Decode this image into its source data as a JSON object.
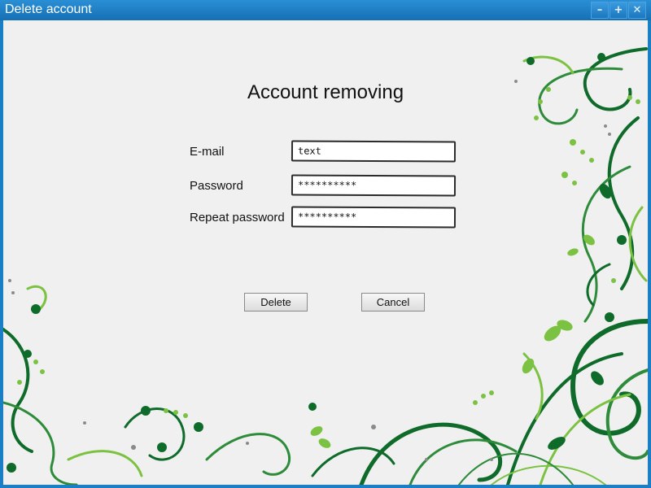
{
  "window": {
    "title": "Delete account",
    "controls": {
      "minimize": "–",
      "maximize": "+",
      "close": "✕"
    }
  },
  "form": {
    "heading": "Account removing",
    "email_label": "E-mail",
    "email_value": "text",
    "password_label": "Password",
    "password_value": "**********",
    "repeat_password_label": "Repeat password",
    "repeat_password_value": "**********"
  },
  "buttons": {
    "delete_label": "Delete",
    "cancel_label": "Cancel"
  },
  "colors": {
    "titlebar": "#1a7fc4",
    "background": "#f0f0f0",
    "decor_dark_green": "#0f6b2a",
    "decor_light_green": "#7cc242",
    "decor_gray": "#8a8a8a"
  },
  "icons": [
    "minimize-icon",
    "maximize-icon",
    "close-icon",
    "floral-decoration"
  ]
}
